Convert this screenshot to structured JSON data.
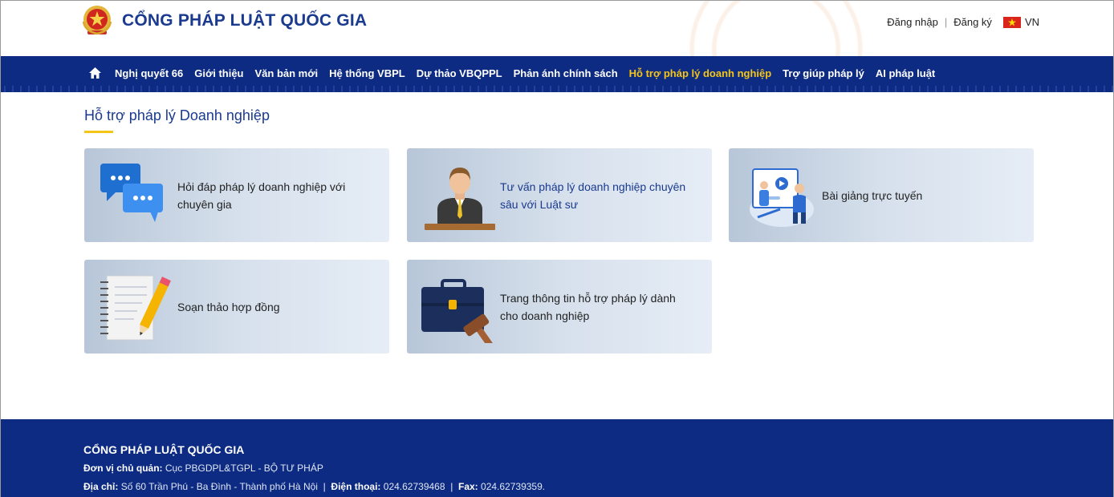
{
  "header": {
    "site_title": "CỔNG PHÁP LUẬT QUỐC GIA",
    "login": "Đăng nhập",
    "register": "Đăng ký",
    "language": "VN"
  },
  "nav": {
    "items": [
      {
        "label": "Nghị quyết 66"
      },
      {
        "label": "Giới thiệu"
      },
      {
        "label": "Văn bản mới"
      },
      {
        "label": "Hệ thống VBPL"
      },
      {
        "label": "Dự thảo VBQPPL"
      },
      {
        "label": "Phản ánh chính sách"
      },
      {
        "label": "Hỗ trợ pháp lý doanh nghiệp",
        "active": true
      },
      {
        "label": "Trợ giúp pháp lý"
      },
      {
        "label": "AI pháp luật"
      }
    ]
  },
  "main": {
    "title": "Hỗ trợ pháp lý Doanh nghiệp",
    "cards": [
      {
        "line1": "Hỏi đáp pháp lý doanh nghiệp với",
        "line2": "chuyên gia",
        "icon": "chat-bubbles-icon"
      },
      {
        "line1": "Tư vấn pháp lý doanh nghiệp chuyên",
        "line2": "sâu với Luật sư",
        "icon": "lawyer-icon"
      },
      {
        "line1": "Bài giảng trực tuyến",
        "line2": "",
        "icon": "online-lecture-icon"
      },
      {
        "line1": "Soạn thảo hợp đồng",
        "line2": "",
        "icon": "contract-notepad-icon"
      },
      {
        "line1": "Trang thông tin hỗ trợ pháp lý dành",
        "line2": "cho doanh nghiệp",
        "icon": "briefcase-gavel-icon"
      }
    ]
  },
  "footer": {
    "title": "CỔNG PHÁP LUẬT QUỐC GIA",
    "agency_label": "Đơn vị chủ quản:",
    "agency_value": "Cục PBGDPL&TGPL - BỘ TƯ PHÁP",
    "address_label": "Địa chỉ:",
    "address_value": "Số 60 Trần Phú - Ba Đình - Thành phố Hà Nội",
    "separator": "|",
    "phone_label": "Điện thoại:",
    "phone_value": "024.62739468",
    "fax_label": "Fax:",
    "fax_value": "024.62739359."
  },
  "colors": {
    "primary": "#0d2b82",
    "accent": "#f5c518",
    "title_blue": "#1a3a8f"
  }
}
